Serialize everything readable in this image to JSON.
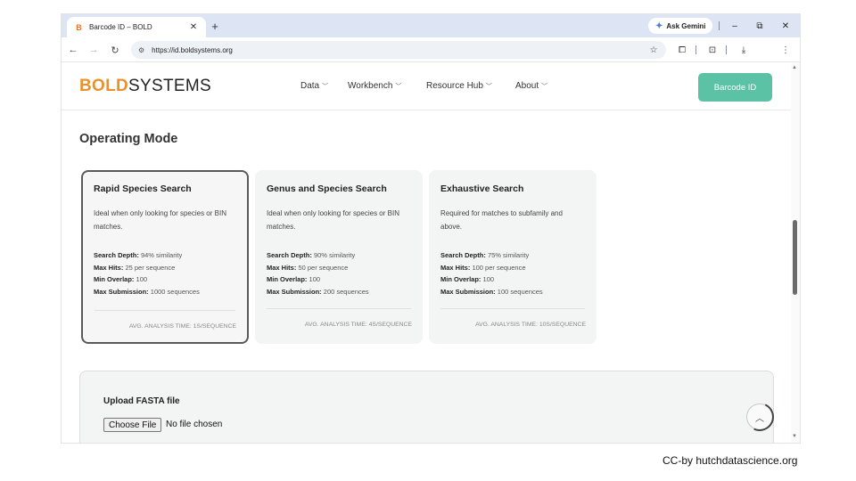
{
  "browser": {
    "tab_title": "Barcode ID – BOLD",
    "tab_favicon": "B",
    "url": "https://id.boldsystems.org",
    "gemini_label": "Ask Gemini",
    "accent": "#dde5f4"
  },
  "site": {
    "logo_a": "BOLD",
    "logo_b": "SYSTEMS",
    "logo_color": "#e8912d",
    "menu": [
      {
        "label": "Data"
      },
      {
        "label": "Workbench"
      },
      {
        "label": "Resource Hub"
      },
      {
        "label": "About"
      }
    ],
    "cta_label": "Barcode ID",
    "cta_color": "#5cc2a6"
  },
  "main": {
    "section_title": "Operating Mode",
    "cards": [
      {
        "title": "Rapid Species Search",
        "description": "Ideal when only looking for species or BIN matches.",
        "specs": [
          {
            "label": "Search Depth:",
            "value": "94% similarity"
          },
          {
            "label": "Max Hits:",
            "value": "25 per sequence"
          },
          {
            "label": "Min Overlap:",
            "value": "100"
          },
          {
            "label": "Max Submission:",
            "value": "1000 sequences"
          }
        ],
        "avg_time": "AVG. ANALYSIS TIME: 1s/sequence",
        "selected": true
      },
      {
        "title": "Genus and Species Search",
        "description": "Ideal when only looking for species or BIN matches.",
        "specs": [
          {
            "label": "Search Depth:",
            "value": "90% similarity"
          },
          {
            "label": "Max Hits:",
            "value": "50 per sequence"
          },
          {
            "label": "Min Overlap:",
            "value": "100"
          },
          {
            "label": "Max Submission:",
            "value": "200 sequences"
          }
        ],
        "avg_time": "AVG. ANALYSIS TIME: 4s/sequence",
        "selected": false
      },
      {
        "title": "Exhaustive Search",
        "description": "Required for matches to subfamily and above.",
        "specs": [
          {
            "label": "Search Depth:",
            "value": "75% similarity"
          },
          {
            "label": "Max Hits:",
            "value": "100 per sequence"
          },
          {
            "label": "Min Overlap:",
            "value": "100"
          },
          {
            "label": "Max Submission:",
            "value": "100 sequences"
          }
        ],
        "avg_time": "AVG. ANALYSIS TIME: 10s/sequence",
        "selected": false
      }
    ],
    "upload": {
      "label": "Upload FASTA file",
      "button_label": "Choose File",
      "status": "No file chosen"
    }
  },
  "credit": "CC-by hutchdatascience.org"
}
